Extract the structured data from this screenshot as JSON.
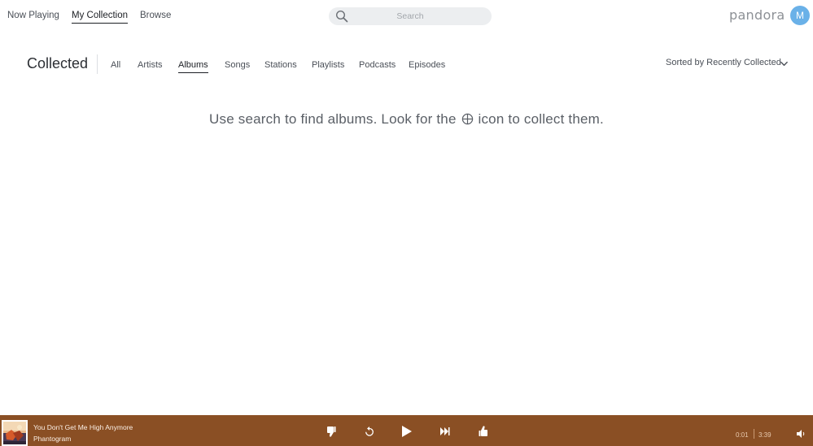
{
  "nav": {
    "now_playing": "Now Playing",
    "my_collection": "My Collection",
    "browse": "Browse"
  },
  "search": {
    "placeholder": "Search"
  },
  "brand": {
    "logo": "pandora",
    "avatar_initial": "M",
    "avatar_color": "#6ab1e8"
  },
  "collection": {
    "title": "Collected",
    "tabs": [
      "All",
      "Artists",
      "Albums",
      "Songs",
      "Stations",
      "Playlists",
      "Podcasts",
      "Episodes"
    ],
    "active_tab": "Albums",
    "sort_label": "Sorted by Recently Collected",
    "empty_before": "Use search to find albums. Look for the",
    "empty_after": "icon to collect them."
  },
  "player": {
    "track_title": "You Don't Get Me High Anymore",
    "artist": "Phantogram",
    "current_time": "0:01",
    "total_time": "3:39",
    "bar_color": "#8a4f24"
  },
  "icons": {
    "search": "search-icon",
    "plus": "circle-plus-icon",
    "chevron": "chevron-down-icon",
    "thumbs_down": "thumbs-down-icon",
    "replay": "replay-icon",
    "play": "play-icon",
    "skip": "skip-forward-icon",
    "thumbs_up": "thumbs-up-icon",
    "volume": "volume-icon"
  }
}
